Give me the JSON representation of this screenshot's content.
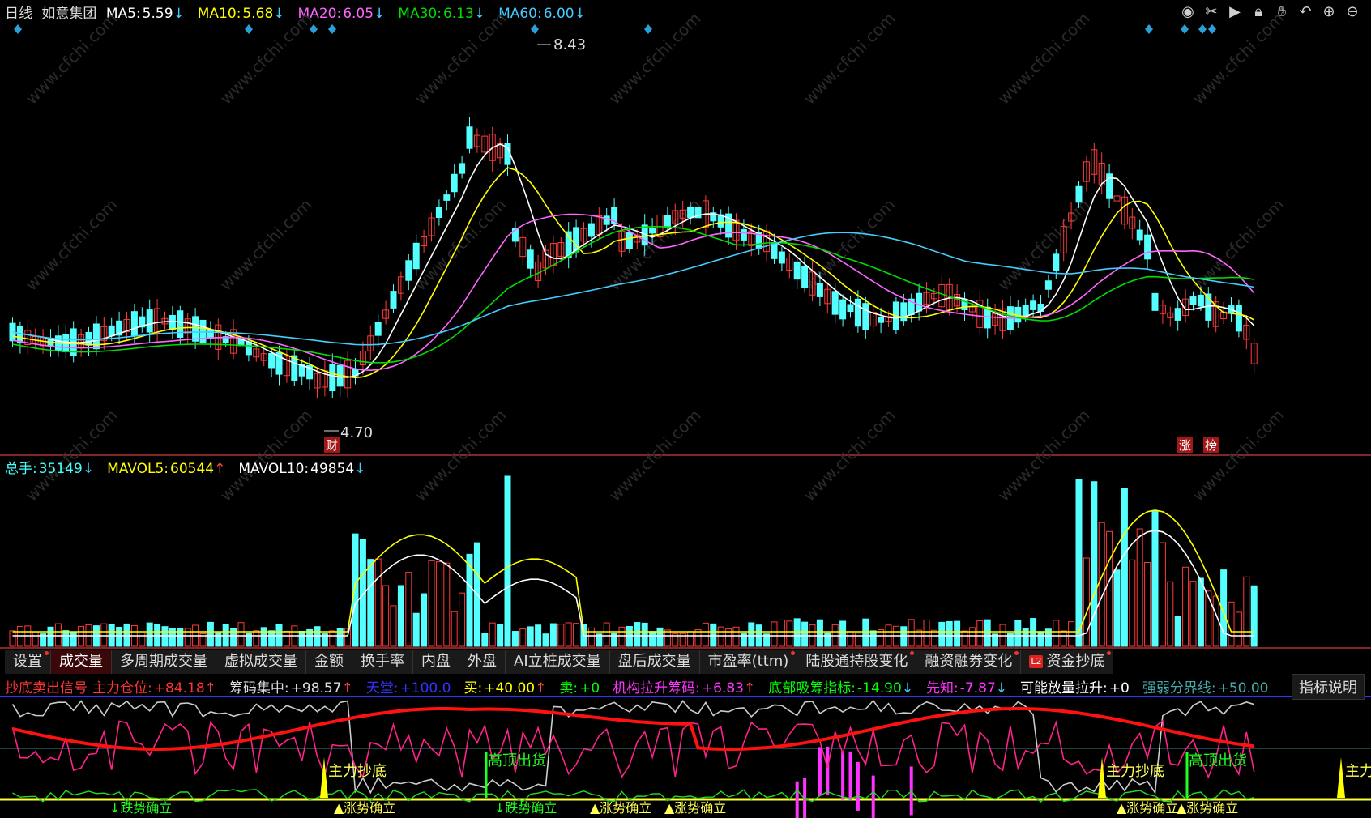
{
  "header": {
    "period": "日线",
    "stock": "如意集团",
    "ma": [
      {
        "label": "MA5:",
        "value": "5.59",
        "arrow": "↓",
        "color": "#ffffff"
      },
      {
        "label": "MA10:",
        "value": "5.68",
        "arrow": "↓",
        "color": "#ffff00"
      },
      {
        "label": "MA20:",
        "value": "6.05",
        "arrow": "↓",
        "color": "#ff66ff"
      },
      {
        "label": "MA30:",
        "value": "6.13",
        "arrow": "↓",
        "color": "#00dd00"
      },
      {
        "label": "MA60:",
        "value": "6.00",
        "arrow": "↓",
        "color": "#44ccff"
      }
    ]
  },
  "toolbar": [
    "eye-icon",
    "scissors-icon",
    "play-icon",
    "lock-icon",
    "hand-icon",
    "undo-icon",
    "zoom-in-icon",
    "zoom-out-icon"
  ],
  "price_chart": {
    "high_label": "8.43",
    "low_label": "4.70",
    "marker_cai": "财",
    "marker_zhang": "涨",
    "marker_bang": "榜",
    "watermark": "www.cfchi.com"
  },
  "volume_header": {
    "items": [
      {
        "label": "总手:",
        "value": "35149",
        "arrow": "↓",
        "color": "#44ffff"
      },
      {
        "label": "MAVOL5:",
        "value": "60544",
        "arrow": "↑",
        "color": "#ffff00"
      },
      {
        "label": "MAVOL10:",
        "value": "49854",
        "arrow": "↓",
        "color": "#ffffff"
      }
    ]
  },
  "tabs": [
    {
      "label": "设置",
      "dot": true
    },
    {
      "label": "成交量",
      "active": true
    },
    {
      "label": "多周期成交量"
    },
    {
      "label": "虚拟成交量"
    },
    {
      "label": "金额"
    },
    {
      "label": "换手率"
    },
    {
      "label": "内盘"
    },
    {
      "label": "外盘"
    },
    {
      "label": "AI立桩成交量"
    },
    {
      "label": "盘后成交量"
    },
    {
      "label": "市盈率(ttm)",
      "dot": true
    },
    {
      "label": "陆股通持股变化",
      "dot": true
    },
    {
      "label": "融资融券变化",
      "dot": true
    },
    {
      "label": "资金抄底",
      "dot": true,
      "l2": "L2"
    }
  ],
  "indicator_header": {
    "title": "抄底卖出信号",
    "items": [
      {
        "label": "主力仓位:",
        "value": "+84.18",
        "arrow": "↑",
        "color": "#ff3333"
      },
      {
        "label": "筹码集中:",
        "value": "+98.57",
        "arrow": "↑",
        "color": "#dddddd"
      },
      {
        "label": "天堂:",
        "value": "+100.0",
        "arrow": "",
        "color": "#3333ff"
      },
      {
        "label": "买:",
        "value": "+40.00",
        "arrow": "↑",
        "color": "#ffff00"
      },
      {
        "label": "卖:",
        "value": "+0",
        "arrow": "",
        "color": "#00ff00"
      },
      {
        "label": "机构拉升筹码:",
        "value": "+6.83",
        "arrow": "↑",
        "color": "#ff33ff"
      },
      {
        "label": "底部吸筹指标:",
        "value": "-14.90",
        "arrow": "↓",
        "color": "#00ff00"
      },
      {
        "label": "先知:",
        "value": "-7.87",
        "arrow": "↓",
        "color": "#ff33ff"
      },
      {
        "label": "可能放量拉升:",
        "value": "+0",
        "arrow": "",
        "color": "#ffffff"
      },
      {
        "label": "强弱分界线:",
        "value": "+50.00",
        "arrow": "",
        "color": "#44aaaa"
      }
    ],
    "explain_button": "指标说明"
  },
  "signals": {
    "bottom_buy": "主力抄底",
    "top_sell": "高顶出货",
    "trend_down": "↓跌势确立",
    "trend_up": "▲涨势确立",
    "main_cut": "主力"
  },
  "colors": {
    "up": "#ff3b3b",
    "down": "#54ffff",
    "ma5": "#ffffff",
    "ma10": "#ffff00",
    "ma20": "#ff66ff",
    "ma30": "#00dd00",
    "ma60": "#44ccff"
  }
}
